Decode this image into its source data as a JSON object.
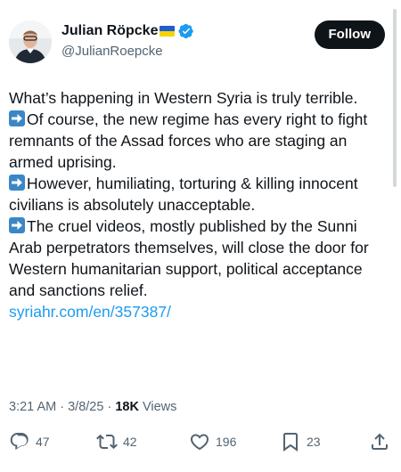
{
  "author": {
    "name": "Julian Röpcke",
    "handle": "@JulianRoepcke",
    "verified": true
  },
  "follow_label": "Follow",
  "tweet": {
    "line1": "What’s happening in Western Syria is truly terrible.",
    "line2": "Of course, the new regime has every right to fight remnants of the Assad forces who are staging an armed uprising.",
    "line3": "However, humiliating, torturing & killing innocent civilians is absolutely unacceptable.",
    "line4": "The cruel videos, mostly published by the Sunni Arab perpetrators themselves, will close the door for Western humanitarian support, political acceptance and sanctions relief.",
    "link": "syriahr.com/en/357387/"
  },
  "meta": {
    "time": "3:21 AM",
    "date": "3/8/25",
    "views_count": "18K",
    "views_label": "Views",
    "separator": "·"
  },
  "actions": {
    "replies": "47",
    "reposts": "42",
    "likes": "196",
    "bookmarks": "23"
  },
  "icons": [
    "avatar-photo",
    "ukraine-flag-icon",
    "verified-badge-icon",
    "right-arrow-emoji-icon",
    "reply-icon",
    "repost-icon",
    "like-icon",
    "bookmark-icon",
    "share-icon"
  ],
  "colors": {
    "link": "#1d9bf0",
    "verified": "#1d9bf0",
    "muted": "#536471",
    "text": "#0f1419"
  }
}
